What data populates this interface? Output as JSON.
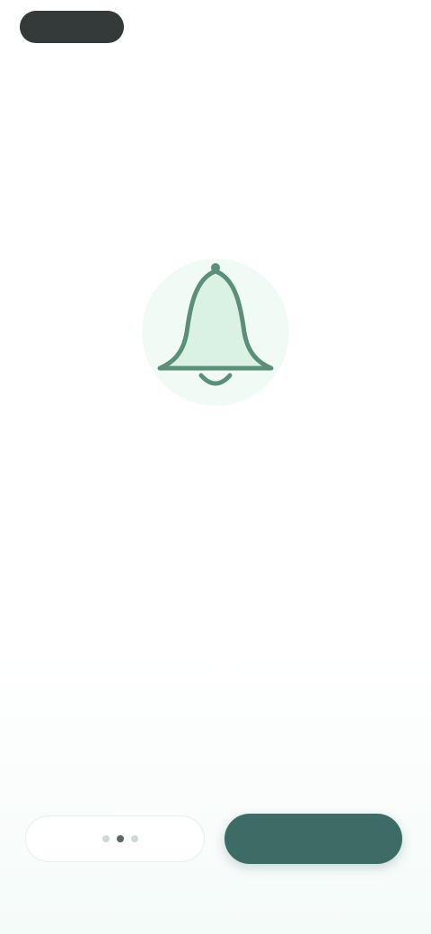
{
  "top_bar": {
    "left_label": "",
    "right_label": ""
  },
  "onboarding": {
    "title": "",
    "body": "",
    "footnote": ""
  },
  "actions": {
    "secondary_label": "",
    "primary_label": "",
    "page_indicator": {
      "current": 2,
      "total": 3
    }
  },
  "colors": {
    "accent": "#3d6c67",
    "illustration_fill": "#d9f2e4",
    "illustration_stroke": "#5b8f79",
    "dark_pill": "#333a39"
  },
  "icons": {
    "illustration": "bell-icon"
  }
}
